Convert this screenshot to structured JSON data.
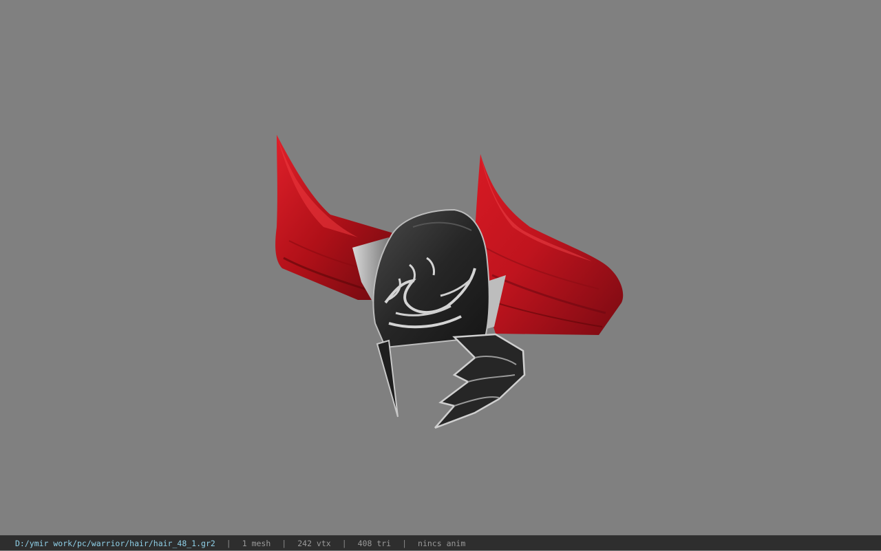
{
  "viewport": {
    "background_color": "#808080",
    "model": {
      "kind": "helmet-with-red-horns",
      "horn_color": "#b0101a",
      "metal_color": "#2a2a2a",
      "trim_color": "#c8c8c8"
    }
  },
  "statusbar": {
    "file_path": "D:/ymir work/pc/warrior/hair/hair_48_1.gr2",
    "separator": "|",
    "mesh_count": "1 mesh",
    "vertex_count": "242 vtx",
    "triangle_count": "408 tri",
    "anim_status": "nincs anim",
    "background_color": "#2e2e2e",
    "path_color": "#8fd0e8"
  }
}
